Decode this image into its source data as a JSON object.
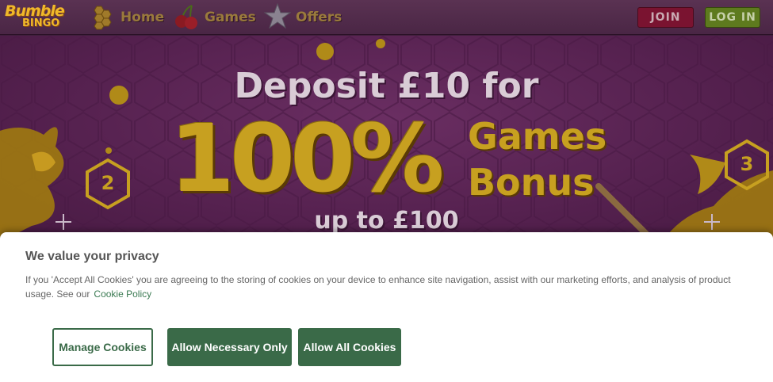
{
  "header": {
    "logo_line1": "Bumble",
    "logo_line2": "BINGO",
    "nav": [
      {
        "label": "Home",
        "icon": "honeycomb-icon"
      },
      {
        "label": "Games",
        "icon": "cherries-icon"
      },
      {
        "label": "Offers",
        "icon": "star-icon"
      }
    ],
    "join_label": "JOIN",
    "login_label": "LOG IN"
  },
  "banner": {
    "line1": "Deposit £10 for",
    "big": "100%",
    "games": "Games",
    "bonus": "Bonus",
    "upto": "up to £100",
    "hex_left": "2",
    "hex_right": "3"
  },
  "cookie": {
    "title": "We value your privacy",
    "text": "If you 'Accept All Cookies' you are agreeing to the storing of cookies on your device to enhance site navigation, assist with our marketing efforts, and analysis of product usage. See our",
    "link": "Cookie Policy",
    "manage_label": "Manage Cookies",
    "necessary_label": "Allow Necessary Only",
    "all_label": "Allow All Cookies"
  },
  "colors": {
    "banner_purple": "#55214f",
    "honey_gold": "#c7a020",
    "join_red": "#7a1330",
    "login_green": "#5e7a1e",
    "cookie_green": "#3a6a48"
  }
}
